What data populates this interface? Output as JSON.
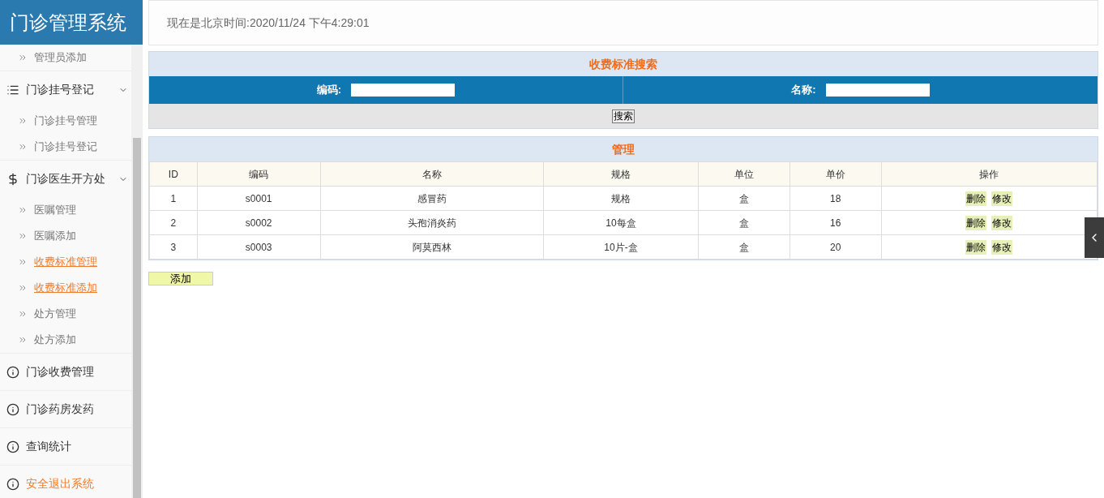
{
  "app_title": "门诊管理系统",
  "sidebar": {
    "items": [
      {
        "kind": "sub",
        "label": "管理员添加",
        "highlighted": false
      },
      {
        "kind": "list",
        "label": "门诊挂号登记",
        "highlighted": false,
        "expanded": true,
        "children": [
          {
            "label": "门诊挂号管理",
            "highlighted": false
          },
          {
            "label": "门诊挂号登记",
            "highlighted": false
          }
        ]
      },
      {
        "kind": "dollar",
        "label": "门诊医生开方处",
        "highlighted": false,
        "expanded": true,
        "children": [
          {
            "label": "医嘱管理",
            "highlighted": false
          },
          {
            "label": "医嘱添加",
            "highlighted": false
          },
          {
            "label": "收费标准管理",
            "highlighted": true
          },
          {
            "label": "收费标准添加",
            "highlighted": true
          },
          {
            "label": "处方管理",
            "highlighted": false
          },
          {
            "label": "处方添加",
            "highlighted": false
          }
        ]
      },
      {
        "kind": "info",
        "label": "门诊收费管理",
        "highlighted": false
      },
      {
        "kind": "info",
        "label": "门诊药房发药",
        "highlighted": false
      },
      {
        "kind": "info",
        "label": "查询统计",
        "highlighted": false
      },
      {
        "kind": "info",
        "label": "安全退出系统",
        "highlighted": true
      }
    ]
  },
  "clock_text": "现在是北京时间:2020/11/24 下午4:29:01",
  "search_panel": {
    "title": "收费标准搜索",
    "fields": [
      {
        "label": "编码:"
      },
      {
        "label": "名称:"
      }
    ],
    "button": "搜索"
  },
  "table_panel": {
    "title": "管理",
    "columns": [
      "ID",
      "编码",
      "名称",
      "规格",
      "单位",
      "单价",
      "操作"
    ],
    "rows": [
      {
        "cells": [
          "1",
          "s0001",
          "感冒药",
          "规格",
          "盒",
          "18"
        ],
        "actions": [
          "删除",
          "修改"
        ]
      },
      {
        "cells": [
          "2",
          "s0002",
          "头孢消炎药",
          "10每盒",
          "盒",
          "16"
        ],
        "actions": [
          "删除",
          "修改"
        ]
      },
      {
        "cells": [
          "3",
          "s0003",
          "阿莫西林",
          "10片-盒",
          "盒",
          "20"
        ],
        "actions": [
          "删除",
          "修改"
        ]
      }
    ]
  },
  "add_button": "添加"
}
